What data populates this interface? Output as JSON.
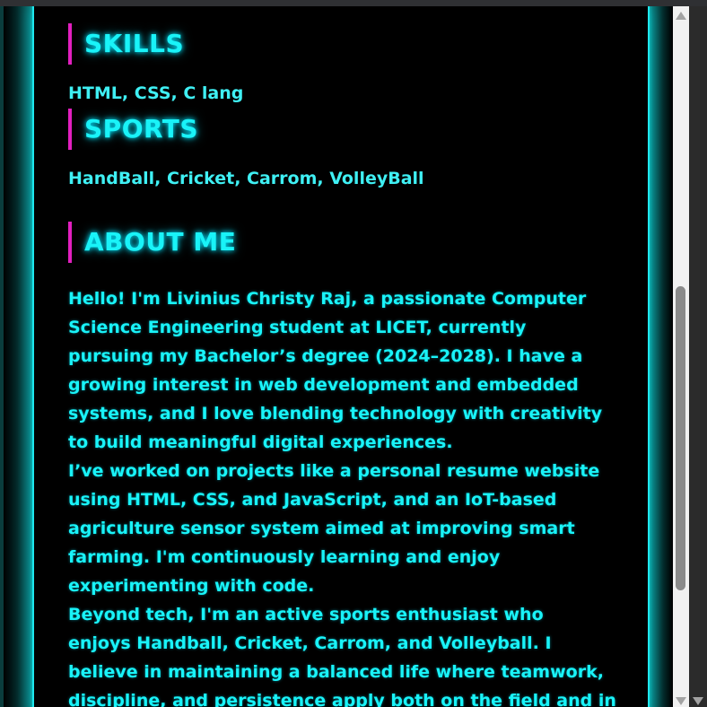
{
  "sections": {
    "skills": {
      "title": "SKILLS",
      "text": "HTML, CSS, C lang"
    },
    "sports": {
      "title": "SPORTS",
      "text": "HandBall, Cricket, Carrom, VolleyBall"
    },
    "about": {
      "title": "ABOUT ME",
      "lines": [
        "Hello! I'm Livinius Christy Raj, a passionate Computer",
        "Science Engineering student at LICET, currently",
        "pursuing my Bachelor’s degree (2024–2028). I have a",
        "growing interest in web development and embedded",
        "systems, and I love blending technology with creativity",
        "to build meaningful digital experiences.",
        "I’ve worked on projects like a personal resume website",
        "using HTML, CSS, and JavaScript, and an IoT-based",
        "agriculture sensor system aimed at improving smart",
        "farming. I'm continuously learning and enjoy",
        "experimenting with code.",
        "Beyond tech, I'm an active sports enthusiast who",
        "enjoys Handball, Cricket, Carrom, and Volleyball. I",
        "believe in maintaining a balanced life where teamwork,",
        "discipline, and persistence apply both on the field and in"
      ]
    }
  },
  "theme": {
    "accent": "#19f3f8",
    "border": "#1ee8ee",
    "marker": "#e21fbf",
    "background": "#000000"
  },
  "scrollbar": {
    "up_icon": "arrow-up-icon",
    "down_icon": "arrow-down-icon"
  }
}
